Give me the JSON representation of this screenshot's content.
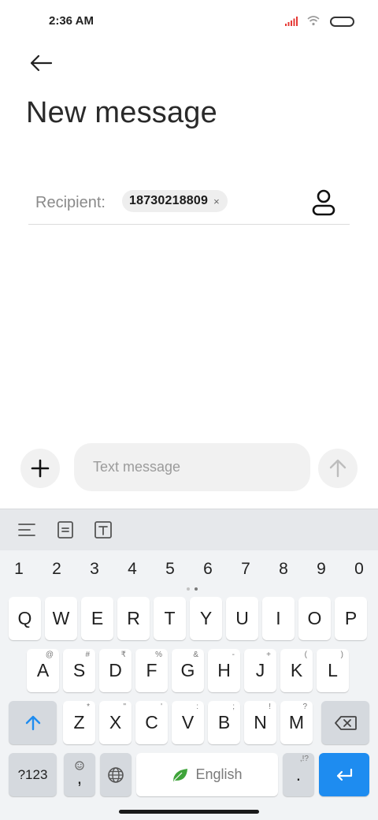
{
  "status_bar": {
    "time": "2:36 AM",
    "signal_color": "#e53935"
  },
  "header": {
    "back_icon": "arrow-left-icon",
    "title": "New message"
  },
  "recipient": {
    "label": "Recipient:",
    "chip_number": "18730218809",
    "chip_remove": "×",
    "contact_icon": "person-icon"
  },
  "compose": {
    "add_icon": "plus-icon",
    "placeholder": "Text message",
    "value": "",
    "send_icon": "arrow-up-icon"
  },
  "keyboard": {
    "toolbar_icons": [
      "text-align-icon",
      "clipboard-icon",
      "text-format-icon"
    ],
    "numbers": [
      "1",
      "2",
      "3",
      "4",
      "5",
      "6",
      "7",
      "8",
      "9",
      "0"
    ],
    "row1": [
      "Q",
      "W",
      "E",
      "R",
      "T",
      "Y",
      "U",
      "I",
      "O",
      "P"
    ],
    "row2": [
      {
        "key": "A",
        "sub": "@"
      },
      {
        "key": "S",
        "sub": "#"
      },
      {
        "key": "D",
        "sub": "₹"
      },
      {
        "key": "F",
        "sub": "%"
      },
      {
        "key": "G",
        "sub": "&"
      },
      {
        "key": "H",
        "sub": "-"
      },
      {
        "key": "J",
        "sub": "+"
      },
      {
        "key": "K",
        "sub": "("
      },
      {
        "key": "L",
        "sub": ")"
      }
    ],
    "row3": [
      {
        "key": "Z",
        "sub": "*"
      },
      {
        "key": "X",
        "sub": "\""
      },
      {
        "key": "C",
        "sub": "'"
      },
      {
        "key": "V",
        "sub": ":"
      },
      {
        "key": "B",
        "sub": ";"
      },
      {
        "key": "N",
        "sub": "!"
      },
      {
        "key": "M",
        "sub": "?"
      }
    ],
    "shift_icon": "shift-arrow-icon",
    "backspace_icon": "backspace-icon",
    "symbols_label": "?123",
    "emoji_comma": ",",
    "emoji_icon": "emoji-icon",
    "globe_icon": "globe-icon",
    "space_label": "English",
    "space_icon": "leaf-icon",
    "period_label": ".",
    "period_sub": ",!?",
    "enter_icon": "enter-icon",
    "accent_color": "#1e8cf0"
  }
}
